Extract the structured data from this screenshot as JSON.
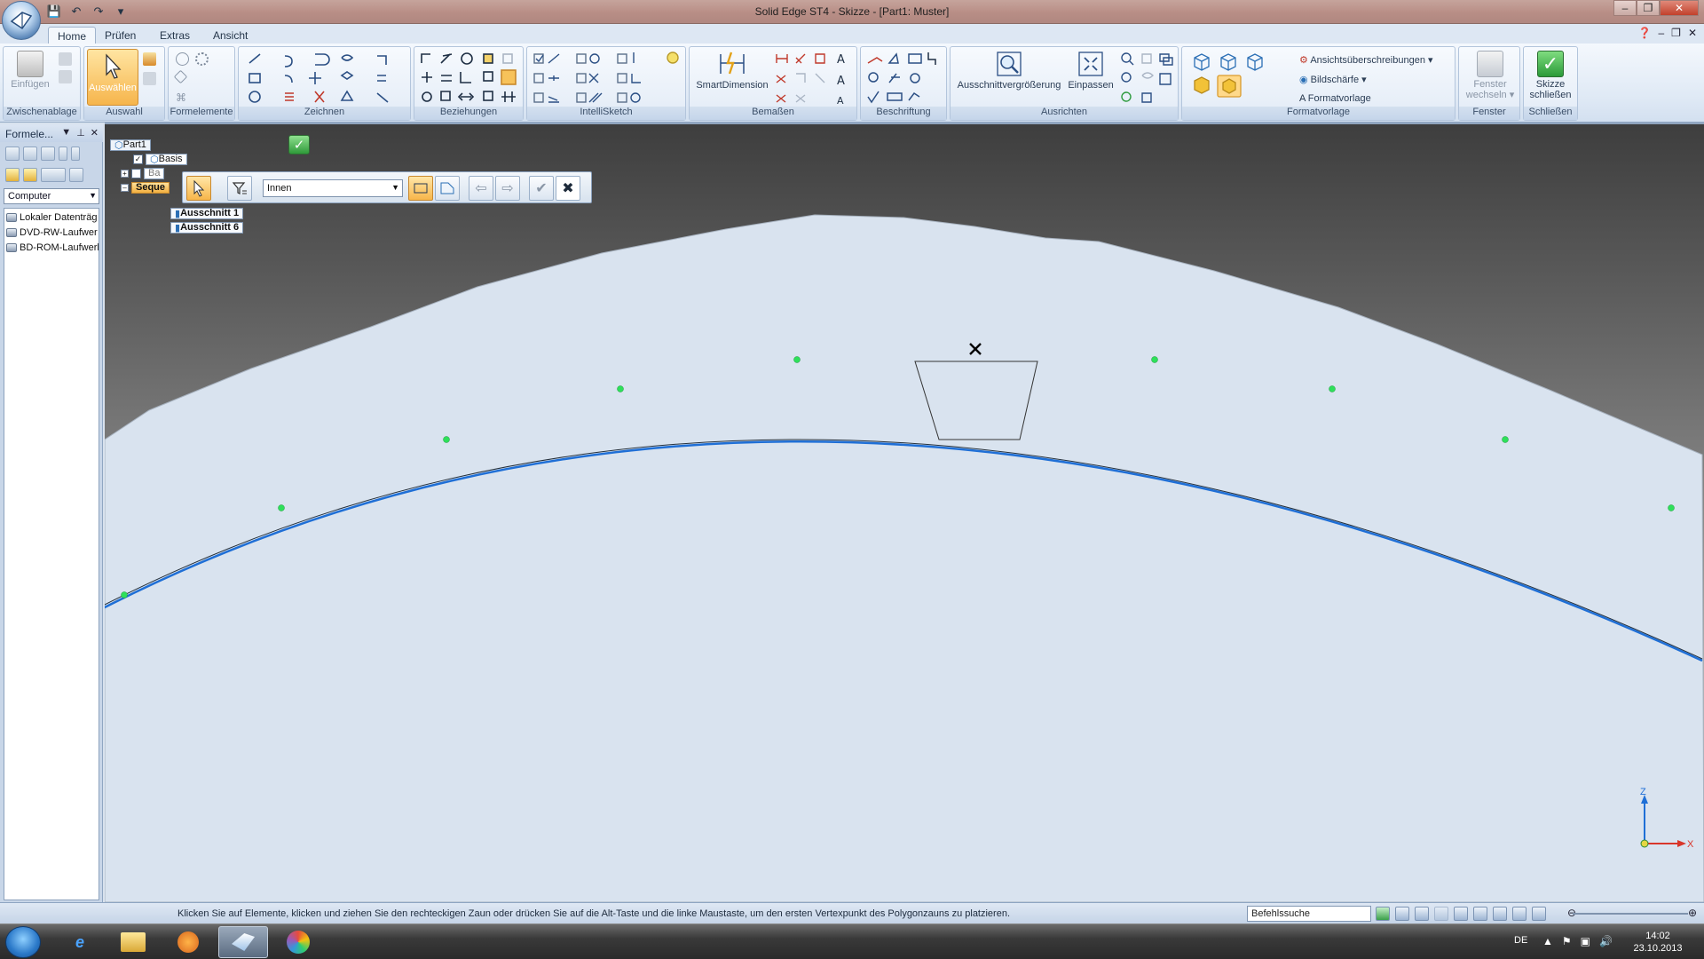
{
  "window": {
    "title": "Solid Edge ST4 - Skizze - [Part1: Muster]",
    "controls": {
      "minimize": "–",
      "restore": "❐",
      "close": "✕"
    }
  },
  "quick_access": [
    "💾",
    "↶",
    "↷",
    "▾"
  ],
  "tabs": [
    {
      "label": "Home",
      "active": true
    },
    {
      "label": "Prüfen",
      "active": false
    },
    {
      "label": "Extras",
      "active": false
    },
    {
      "label": "Ansicht",
      "active": false
    }
  ],
  "ribbon": {
    "groups": {
      "clipboard": {
        "label": "Zwischenablage",
        "paste": "Einfügen"
      },
      "select": {
        "label": "Auswahl",
        "select": "Auswählen"
      },
      "features": {
        "label": "Formelemente"
      },
      "draw": {
        "label": "Zeichnen"
      },
      "relations": {
        "label": "Beziehungen"
      },
      "intellisketch": {
        "label": "IntelliSketch"
      },
      "dimension": {
        "label": "Bemaßen",
        "smart": "SmartDimension"
      },
      "annotation": {
        "label": "Beschriftung"
      },
      "orient": {
        "label": "Ausrichten",
        "zoom_area": "Ausschnittvergrößerung",
        "fit": "Einpassen"
      },
      "style": {
        "label": "Formatvorlage",
        "overrides": "Ansichtsüberschreibungen",
        "sharpness": "Bildschärfe",
        "style": "Formatvorlage"
      },
      "window": {
        "label": "Fenster",
        "switch_line1": "Fenster",
        "switch_line2": "wechseln"
      },
      "close": {
        "label": "Schließen",
        "close_line1": "Skizze",
        "close_line2": "schließen"
      }
    }
  },
  "left_panel": {
    "title": "Formele...",
    "combo": "Computer",
    "drives": [
      "Lokaler Datenträg",
      "DVD-RW-Laufwer",
      "BD-ROM-Laufwerl"
    ]
  },
  "pathfinder": {
    "root": "Part1",
    "base": "Basis",
    "base2": "Ba",
    "sequence": "Seque",
    "sections": [
      "Ausschnitt 1",
      "Ausschnitt 6"
    ]
  },
  "command_bar": {
    "select_value": "Innen"
  },
  "triad": {
    "z": "Z",
    "x": "X"
  },
  "status": {
    "prompt": "Klicken Sie auf Elemente, klicken und ziehen Sie den rechteckigen Zaun oder drücken Sie auf die Alt-Taste und die linke Maustaste, um den ersten Vertexpunkt des Polygonzauns zu platzieren.",
    "command_search": "Befehlssuche"
  },
  "taskbar": {
    "language": "DE",
    "time": "14:02",
    "date": "23.10.2013"
  }
}
